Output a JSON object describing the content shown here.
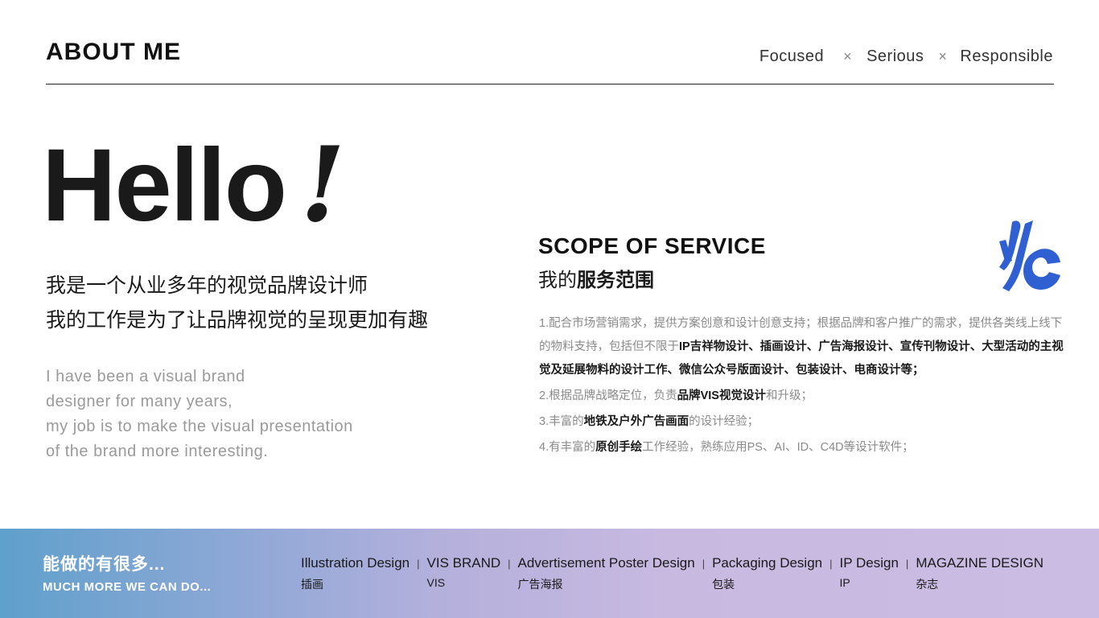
{
  "header": {
    "title": "ABOUT ME",
    "tags": [
      "Focused",
      "Serious",
      "Responsible"
    ],
    "separator": "×"
  },
  "hello": {
    "word": "Hello",
    "exclaim": "!"
  },
  "intro": {
    "cn_lines": [
      "我是一个从业多年的视觉品牌设计师",
      "我的工作是为了让品牌视觉的呈现更加有趣"
    ],
    "en_lines": [
      "I have been a visual brand",
      "designer for many years,",
      "my job is to make the visual presentation",
      "of the brand more interesting."
    ]
  },
  "scope": {
    "title": "SCOPE OF SERVICE",
    "cn_prefix": "我的",
    "cn_bold": "服务范围",
    "logo_icon": "brand-monogram-icon",
    "logo_color": "#2f5fd0",
    "items": [
      {
        "a": "1.配合市场营销需求，提供方案创意和设计创意支持；根据品牌和客户推广的需求，提供各类线上线下的物料支持，包括但不限于",
        "b": "IP吉祥物设计、插画设计、广告海报设计、宣传刊物设计、大型活动的主视觉及延展物料的设计工作、微信公众号版面设计、包装设计、电商设计等；",
        "c": ""
      },
      {
        "a": "2.根据品牌战略定位，负责",
        "b": "品牌VIS视觉设计",
        "c": "和升级；"
      },
      {
        "a": "3.丰富的",
        "b": "地铁及户外广告画面",
        "c": "的设计经验；"
      },
      {
        "a": "4.有丰富的",
        "b": "原创手绘",
        "c": "工作经验，熟练应用PS、AI、ID、C4D等设计软件；"
      }
    ]
  },
  "footer": {
    "cn": "能做的有很多...",
    "en": "MUCH MORE WE CAN DO...",
    "separator": "|",
    "categories": [
      {
        "en": "Illustration Design",
        "cn": "插画"
      },
      {
        "en": "VIS BRAND",
        "cn": "VIS"
      },
      {
        "en": "Advertisement Poster Design",
        "cn": "广告海报"
      },
      {
        "en": "Packaging Design",
        "cn": "包装"
      },
      {
        "en": "IP Design",
        "cn": "IP"
      },
      {
        "en": "MAGAZINE DESIGN",
        "cn": "杂志"
      }
    ]
  }
}
